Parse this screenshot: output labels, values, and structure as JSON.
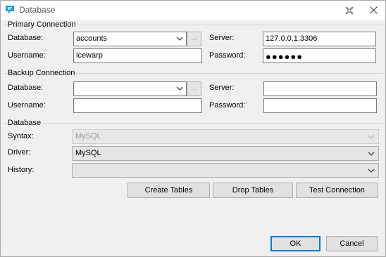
{
  "window": {
    "title": "Database"
  },
  "primary": {
    "section_label": "Primary Connection",
    "database_label": "Database:",
    "database_value": "accounts",
    "browse_label": "...",
    "server_label": "Server:",
    "server_value": "127.0.0.1:3306",
    "username_label": "Username:",
    "username_value": "icewarp",
    "password_label": "Password:",
    "password_value": "●●●●●●"
  },
  "backup": {
    "section_label": "Backup Connection",
    "database_label": "Database:",
    "database_value": "",
    "browse_label": "...",
    "server_label": "Server:",
    "server_value": "",
    "username_label": "Username:",
    "username_value": "",
    "password_label": "Password:",
    "password_value": ""
  },
  "database": {
    "section_label": "Database",
    "syntax_label": "Syntax:",
    "syntax_value": "MySQL",
    "driver_label": "Driver:",
    "driver_value": "MySQL",
    "history_label": "History:",
    "history_value": "",
    "create_tables": "Create Tables",
    "drop_tables": "Drop Tables",
    "test_connection": "Test Connection"
  },
  "footer": {
    "ok": "OK",
    "cancel": "Cancel"
  },
  "icons": {
    "app": "database-app-icon",
    "settings": "settings-icon",
    "close": "close-icon",
    "chevron": "chevron-down-icon"
  },
  "colors": {
    "accent": "#0078d7",
    "app_icon": "#1e9fd8"
  }
}
